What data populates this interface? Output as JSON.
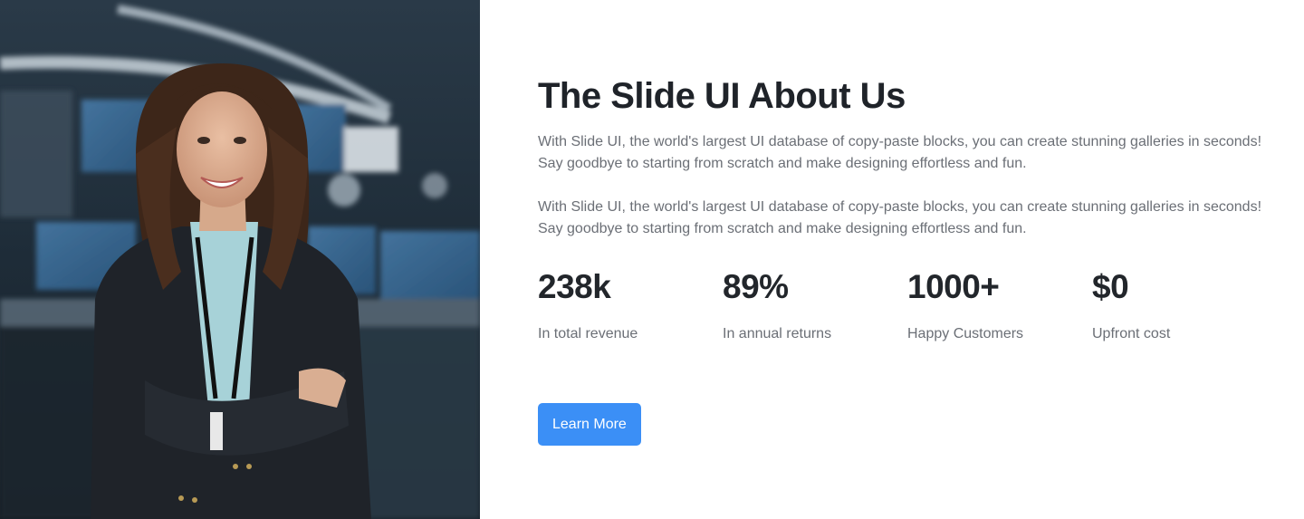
{
  "about": {
    "title": "The Slide UI About Us",
    "paragraphs": [
      "With Slide UI, the world's largest UI database of copy-paste blocks, you can create stunning galleries in seconds! Say goodbye to starting from scratch and make designing effortless and fun.",
      "With Slide UI, the world's largest UI database of copy-paste blocks, you can create stunning galleries in seconds! Say goodbye to starting from scratch and make designing effortless and fun."
    ],
    "stats": [
      {
        "value": "238k",
        "label": "In total revenue"
      },
      {
        "value": "89%",
        "label": "In annual returns"
      },
      {
        "value": "1000+",
        "label": "Happy Customers"
      },
      {
        "value": "$0",
        "label": "Upfront cost"
      }
    ],
    "button_label": "Learn More"
  },
  "colors": {
    "accent": "#3b8ff6",
    "heading": "#1f2329",
    "body_text": "#6b6f76"
  }
}
